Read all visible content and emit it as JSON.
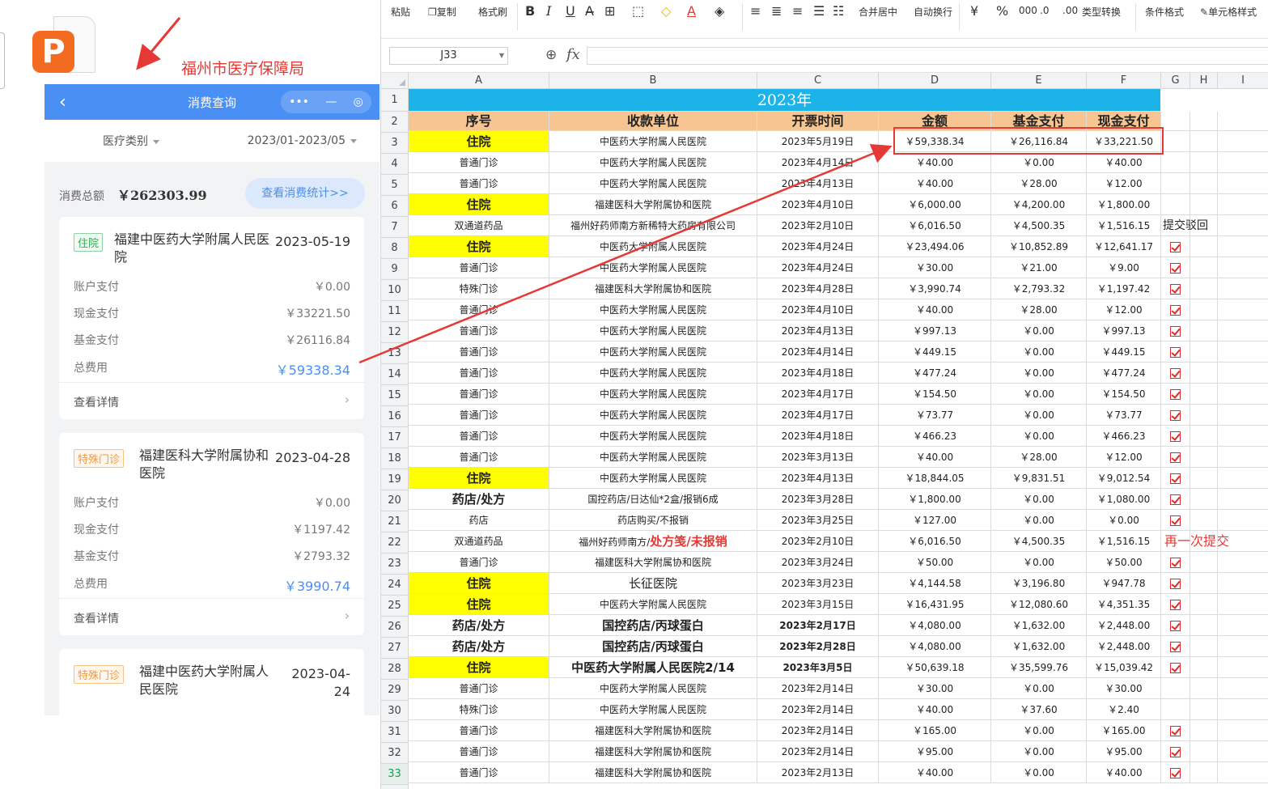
{
  "annotation": {
    "bureau_title": "福州市医疗保障局",
    "resubmit_note": "再一次提交",
    "reject_note": "提交驳回"
  },
  "app": {
    "nav_title": "消费查询",
    "filter_category": "医疗类别",
    "filter_range": "2023/01-2023/05",
    "total_label": "消费总额",
    "total_amount": "￥262303.99",
    "stats_button": "查看消费统计>>",
    "row_labels": {
      "account": "账户支付",
      "cash": "现金支付",
      "fund": "基金支付",
      "total": "总费用"
    },
    "detail_label": "查看详情",
    "cards": [
      {
        "tag": "住院",
        "name": "福建中医药大学附属人民医院",
        "date": "2023-05-19",
        "account": "￥0.00",
        "cash": "￥33221.50",
        "fund": "￥26116.84",
        "total": "￥59338.34"
      },
      {
        "tag": "特殊门诊",
        "name": "福建医科大学附属协和医院",
        "date": "2023-04-28",
        "account": "￥0.00",
        "cash": "￥1197.42",
        "fund": "￥2793.32",
        "total": "￥3990.74"
      },
      {
        "tag": "特殊门诊",
        "name": "福建中医药大学附属人民医院",
        "date": "2023-04-24"
      }
    ]
  },
  "ribbon": {
    "items": [
      "粘贴",
      "复制",
      "格式刷",
      "B",
      "I",
      "U",
      "合并居中",
      "自动换行",
      "类型转换",
      "条件格式",
      "单元格样式"
    ]
  },
  "formula_bar": {
    "cell_ref": "J33",
    "fx": "fx",
    "formula": ""
  },
  "sheet": {
    "col_headers": [
      "A",
      "B",
      "C",
      "D",
      "E",
      "F",
      "G",
      "H",
      "I"
    ],
    "title": "2023年",
    "headers": [
      "序号",
      "收款单位",
      "开票时间",
      "金额",
      "基金支付",
      "现金支付"
    ],
    "rows": [
      {
        "n": 3,
        "type": "住院",
        "unit": "中医药大学附属人民医院",
        "date": "2023年5月19日",
        "amt": "￥59,338.34",
        "fund": "￥26,116.84",
        "cash": "￥33,221.50",
        "mark": ""
      },
      {
        "n": 4,
        "type": "普通门诊",
        "unit": "中医药大学附属人民医院",
        "date": "2023年4月14日",
        "amt": "￥40.00",
        "fund": "￥0.00",
        "cash": "￥40.00",
        "mark": ""
      },
      {
        "n": 5,
        "type": "普通门诊",
        "unit": "中医药大学附属人民医院",
        "date": "2023年4月13日",
        "amt": "￥40.00",
        "fund": "￥28.00",
        "cash": "￥12.00",
        "mark": ""
      },
      {
        "n": 6,
        "type": "住院",
        "unit": "福建医科大学附属协和医院",
        "date": "2023年4月10日",
        "amt": "￥6,000.00",
        "fund": "￥4,200.00",
        "cash": "￥1,800.00",
        "mark": ""
      },
      {
        "n": 7,
        "type": "双通道药品",
        "unit": "福州好药师南方新稀特大药房有限公司",
        "date": "2023年2月10日",
        "amt": "￥6,016.50",
        "fund": "￥4,500.35",
        "cash": "￥1,516.15",
        "mark": "reject"
      },
      {
        "n": 8,
        "type": "住院",
        "unit": "中医药大学附属人民医院",
        "date": "2023年4月24日",
        "amt": "￥23,494.06",
        "fund": "￥10,852.89",
        "cash": "￥12,641.17",
        "mark": "check"
      },
      {
        "n": 9,
        "type": "普通门诊",
        "unit": "中医药大学附属人民医院",
        "date": "2023年4月24日",
        "amt": "￥30.00",
        "fund": "￥21.00",
        "cash": "￥9.00",
        "mark": "check"
      },
      {
        "n": 10,
        "type": "特殊门诊",
        "unit": "福建医科大学附属协和医院",
        "date": "2023年4月28日",
        "amt": "￥3,990.74",
        "fund": "￥2,793.32",
        "cash": "￥1,197.42",
        "mark": "check"
      },
      {
        "n": 11,
        "type": "普通门诊",
        "unit": "中医药大学附属人民医院",
        "date": "2023年4月10日",
        "amt": "￥40.00",
        "fund": "￥28.00",
        "cash": "￥12.00",
        "mark": "check"
      },
      {
        "n": 12,
        "type": "普通门诊",
        "unit": "中医药大学附属人民医院",
        "date": "2023年4月13日",
        "amt": "￥997.13",
        "fund": "￥0.00",
        "cash": "￥997.13",
        "mark": "check"
      },
      {
        "n": 13,
        "type": "普通门诊",
        "unit": "中医药大学附属人民医院",
        "date": "2023年4月14日",
        "amt": "￥449.15",
        "fund": "￥0.00",
        "cash": "￥449.15",
        "mark": "check"
      },
      {
        "n": 14,
        "type": "普通门诊",
        "unit": "中医药大学附属人民医院",
        "date": "2023年4月18日",
        "amt": "￥477.24",
        "fund": "￥0.00",
        "cash": "￥477.24",
        "mark": "check"
      },
      {
        "n": 15,
        "type": "普通门诊",
        "unit": "中医药大学附属人民医院",
        "date": "2023年4月17日",
        "amt": "￥154.50",
        "fund": "￥0.00",
        "cash": "￥154.50",
        "mark": "check"
      },
      {
        "n": 16,
        "type": "普通门诊",
        "unit": "中医药大学附属人民医院",
        "date": "2023年4月17日",
        "amt": "￥73.77",
        "fund": "￥0.00",
        "cash": "￥73.77",
        "mark": "check"
      },
      {
        "n": 17,
        "type": "普通门诊",
        "unit": "中医药大学附属人民医院",
        "date": "2023年4月18日",
        "amt": "￥466.23",
        "fund": "￥0.00",
        "cash": "￥466.23",
        "mark": "check"
      },
      {
        "n": 18,
        "type": "普通门诊",
        "unit": "中医药大学附属人民医院",
        "date": "2023年3月13日",
        "amt": "￥40.00",
        "fund": "￥28.00",
        "cash": "￥12.00",
        "mark": "check"
      },
      {
        "n": 19,
        "type": "住院",
        "unit": "中医药大学附属人民医院",
        "date": "2023年4月13日",
        "amt": "￥18,844.05",
        "fund": "￥9,831.51",
        "cash": "￥9,012.54",
        "mark": "check"
      },
      {
        "n": 20,
        "type": "药店/处方",
        "unit": "国控药店/日达仙*2盒/报销6成",
        "date": "2023年3月28日",
        "amt": "￥1,800.00",
        "fund": "￥0.00",
        "cash": "￥1,080.00",
        "mark": "check"
      },
      {
        "n": 21,
        "type": "药店",
        "unit": "药店购买/不报销",
        "date": "2023年3月25日",
        "amt": "￥127.00",
        "fund": "￥0.00",
        "cash": "￥0.00",
        "mark": "check"
      },
      {
        "n": 22,
        "type": "双通道药品",
        "unit": "福州好药师南方/",
        "unit_red": "处方笺/未报销",
        "date": "2023年2月10日",
        "amt": "￥6,016.50",
        "fund": "￥4,500.35",
        "cash": "￥1,516.15",
        "mark": "resubmit"
      },
      {
        "n": 23,
        "type": "普通门诊",
        "unit": "福建医科大学附属协和医院",
        "date": "2023年3月24日",
        "amt": "￥50.00",
        "fund": "￥0.00",
        "cash": "￥50.00",
        "mark": "check"
      },
      {
        "n": 24,
        "type": "住院",
        "unit": "长征医院",
        "date": "2023年3月23日",
        "amt": "￥4,144.58",
        "fund": "￥3,196.80",
        "cash": "￥947.78",
        "mark": "check"
      },
      {
        "n": 25,
        "type": "住院",
        "unit": "中医药大学附属人民医院",
        "date": "2023年3月15日",
        "amt": "￥16,431.95",
        "fund": "￥12,080.60",
        "cash": "￥4,351.35",
        "mark": "check"
      },
      {
        "n": 26,
        "type": "药店/处方",
        "unit": "国控药店/丙球蛋白",
        "date": "2023年2月17日",
        "amt": "￥4,080.00",
        "fund": "￥1,632.00",
        "cash": "￥2,448.00",
        "mark": "check"
      },
      {
        "n": 27,
        "type": "药店/处方",
        "unit": "国控药店/丙球蛋白",
        "date": "2023年2月28日",
        "amt": "￥4,080.00",
        "fund": "￥1,632.00",
        "cash": "￥2,448.00",
        "mark": "check"
      },
      {
        "n": 28,
        "type": "住院",
        "unit": "中医药大学附属人民医院2/14",
        "date": "2023年3月5日",
        "amt": "￥50,639.18",
        "fund": "￥35,599.76",
        "cash": "￥15,039.42",
        "mark": "check"
      },
      {
        "n": 29,
        "type": "普通门诊",
        "unit": "中医药大学附属人民医院",
        "date": "2023年2月14日",
        "amt": "￥30.00",
        "fund": "￥0.00",
        "cash": "￥30.00",
        "mark": ""
      },
      {
        "n": 30,
        "type": "特殊门诊",
        "unit": "中医药大学附属人民医院",
        "date": "2023年2月14日",
        "amt": "￥40.00",
        "fund": "￥37.60",
        "cash": "￥2.40",
        "mark": ""
      },
      {
        "n": 31,
        "type": "普通门诊",
        "unit": "福建医科大学附属协和医院",
        "date": "2023年2月14日",
        "amt": "￥165.00",
        "fund": "￥0.00",
        "cash": "￥165.00",
        "mark": "check"
      },
      {
        "n": 32,
        "type": "普通门诊",
        "unit": "福建医科大学附属协和医院",
        "date": "2023年2月14日",
        "amt": "￥95.00",
        "fund": "￥0.00",
        "cash": "￥95.00",
        "mark": "check"
      },
      {
        "n": 33,
        "type": "普通门诊",
        "unit": "福建医科大学附属协和医院",
        "date": "2023年2月13日",
        "amt": "￥40.00",
        "fund": "￥0.00",
        "cash": "￥40.00",
        "mark": "check"
      }
    ]
  },
  "colors": {
    "nav_blue": "#4a8ff3",
    "title_cyan": "#1cb4e8",
    "header_peach": "#f7c592",
    "highlight_yellow": "#ffff00",
    "annotation_red": "#e53935"
  }
}
